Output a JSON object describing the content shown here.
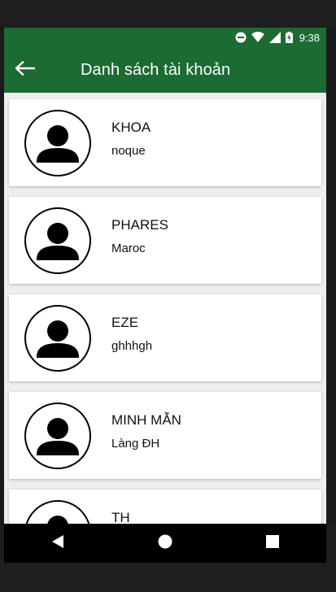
{
  "status_bar": {
    "time": "9:38",
    "icons": [
      "do-not-disturb-icon",
      "wifi-icon",
      "signal-icon",
      "battery-charging-icon"
    ]
  },
  "app_bar": {
    "back_icon": "arrow-back-icon",
    "title": "Danh sách tài khoản"
  },
  "accounts": [
    {
      "name": "KHOA",
      "subtitle": "noque"
    },
    {
      "name": "PHARES",
      "subtitle": "Maroc"
    },
    {
      "name": "EZE",
      "subtitle": "ghhhgh"
    },
    {
      "name": "MINH MẪN",
      "subtitle": "Làng ĐH"
    },
    {
      "name": "TH",
      "subtitle": ""
    }
  ],
  "nav_bar": {
    "icons": [
      "back-triangle-icon",
      "home-circle-icon",
      "recents-square-icon"
    ]
  },
  "colors": {
    "primary": "#1b6b33",
    "background": "#eeeeee",
    "card": "#ffffff"
  }
}
